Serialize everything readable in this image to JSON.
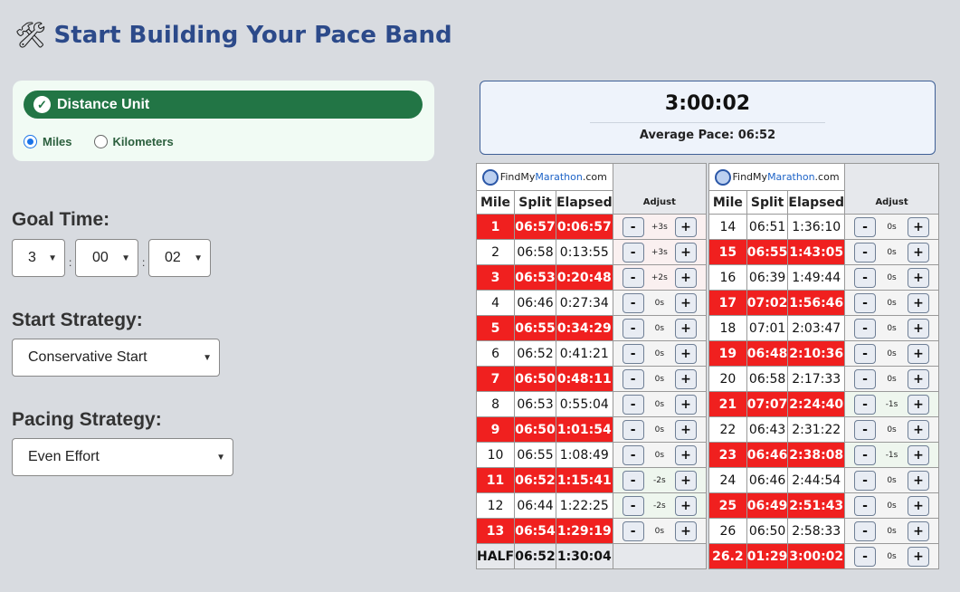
{
  "page": {
    "title": "Start Building Your Pace Band",
    "title_icon": "tools-icon"
  },
  "distance_unit": {
    "header": "Distance Unit",
    "options": [
      {
        "label": "Miles",
        "selected": true
      },
      {
        "label": "Kilometers",
        "selected": false
      }
    ]
  },
  "goal_time": {
    "label": "Goal Time:",
    "hours": "3",
    "minutes": "00",
    "seconds": "02",
    "separator": ":"
  },
  "start_strategy": {
    "label": "Start Strategy:",
    "value": "Conservative Start"
  },
  "pacing_strategy": {
    "label": "Pacing Strategy:",
    "value": "Even Effort"
  },
  "summary": {
    "total_time": "3:00:02",
    "average_pace": "Average Pace: 06:52"
  },
  "band": {
    "logo": {
      "prefix": "Find",
      "my": "My",
      "marathon": "Marathon",
      "suffix": ".com"
    },
    "headers": {
      "mile": "Mile",
      "split": "Split",
      "elapsed": "Elapsed",
      "adjust": "Adjust"
    },
    "minus_label": "-",
    "plus_label": "+",
    "left": [
      {
        "mile": "1",
        "split": "06:57",
        "elapsed": "0:06:57",
        "adj": "+3s",
        "red": true,
        "tint": "pink"
      },
      {
        "mile": "2",
        "split": "06:58",
        "elapsed": "0:13:55",
        "adj": "+3s",
        "red": false,
        "tint": "pink"
      },
      {
        "mile": "3",
        "split": "06:53",
        "elapsed": "0:20:48",
        "adj": "+2s",
        "red": true,
        "tint": "pink"
      },
      {
        "mile": "4",
        "split": "06:46",
        "elapsed": "0:27:34",
        "adj": "0s",
        "red": false,
        "tint": ""
      },
      {
        "mile": "5",
        "split": "06:55",
        "elapsed": "0:34:29",
        "adj": "0s",
        "red": true,
        "tint": ""
      },
      {
        "mile": "6",
        "split": "06:52",
        "elapsed": "0:41:21",
        "adj": "0s",
        "red": false,
        "tint": ""
      },
      {
        "mile": "7",
        "split": "06:50",
        "elapsed": "0:48:11",
        "adj": "0s",
        "red": true,
        "tint": ""
      },
      {
        "mile": "8",
        "split": "06:53",
        "elapsed": "0:55:04",
        "adj": "0s",
        "red": false,
        "tint": ""
      },
      {
        "mile": "9",
        "split": "06:50",
        "elapsed": "1:01:54",
        "adj": "0s",
        "red": true,
        "tint": ""
      },
      {
        "mile": "10",
        "split": "06:55",
        "elapsed": "1:08:49",
        "adj": "0s",
        "red": false,
        "tint": ""
      },
      {
        "mile": "11",
        "split": "06:52",
        "elapsed": "1:15:41",
        "adj": "-2s",
        "red": true,
        "tint": "green"
      },
      {
        "mile": "12",
        "split": "06:44",
        "elapsed": "1:22:25",
        "adj": "-2s",
        "red": false,
        "tint": "green"
      },
      {
        "mile": "13",
        "split": "06:54",
        "elapsed": "1:29:19",
        "adj": "0s",
        "red": true,
        "tint": ""
      }
    ],
    "half": {
      "mile": "HALF",
      "split": "06:52",
      "elapsed": "1:30:04"
    },
    "right": [
      {
        "mile": "14",
        "split": "06:51",
        "elapsed": "1:36:10",
        "adj": "0s",
        "red": false,
        "tint": ""
      },
      {
        "mile": "15",
        "split": "06:55",
        "elapsed": "1:43:05",
        "adj": "0s",
        "red": true,
        "tint": ""
      },
      {
        "mile": "16",
        "split": "06:39",
        "elapsed": "1:49:44",
        "adj": "0s",
        "red": false,
        "tint": ""
      },
      {
        "mile": "17",
        "split": "07:02",
        "elapsed": "1:56:46",
        "adj": "0s",
        "red": true,
        "tint": ""
      },
      {
        "mile": "18",
        "split": "07:01",
        "elapsed": "2:03:47",
        "adj": "0s",
        "red": false,
        "tint": ""
      },
      {
        "mile": "19",
        "split": "06:48",
        "elapsed": "2:10:36",
        "adj": "0s",
        "red": true,
        "tint": ""
      },
      {
        "mile": "20",
        "split": "06:58",
        "elapsed": "2:17:33",
        "adj": "0s",
        "red": false,
        "tint": ""
      },
      {
        "mile": "21",
        "split": "07:07",
        "elapsed": "2:24:40",
        "adj": "-1s",
        "red": true,
        "tint": "green"
      },
      {
        "mile": "22",
        "split": "06:43",
        "elapsed": "2:31:22",
        "adj": "0s",
        "red": false,
        "tint": ""
      },
      {
        "mile": "23",
        "split": "06:46",
        "elapsed": "2:38:08",
        "adj": "-1s",
        "red": true,
        "tint": "green"
      },
      {
        "mile": "24",
        "split": "06:46",
        "elapsed": "2:44:54",
        "adj": "0s",
        "red": false,
        "tint": ""
      },
      {
        "mile": "25",
        "split": "06:49",
        "elapsed": "2:51:43",
        "adj": "0s",
        "red": true,
        "tint": ""
      },
      {
        "mile": "26",
        "split": "06:50",
        "elapsed": "2:58:33",
        "adj": "0s",
        "red": false,
        "tint": ""
      },
      {
        "mile": "26.2",
        "split": "01:29",
        "elapsed": "3:00:02",
        "adj": "0s",
        "red": true,
        "tint": ""
      }
    ]
  }
}
